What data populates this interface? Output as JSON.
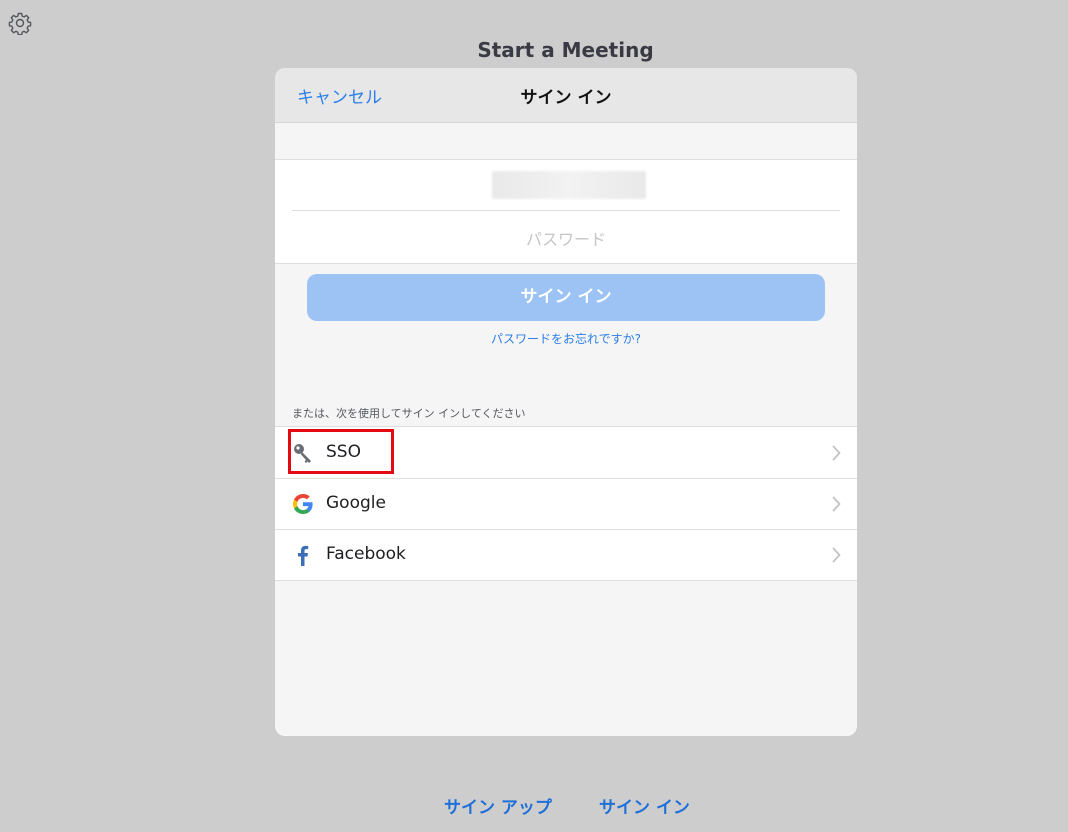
{
  "header": {
    "title": "Start a Meeting"
  },
  "modal": {
    "cancel_label": "キャンセル",
    "title": "サイン イン",
    "password_placeholder": "パスワード",
    "signin_label": "サイン イン",
    "forgot_label": "パスワードをお忘れですか?",
    "or_label": "または、次を使用してサイン インしてください",
    "options": [
      {
        "label": "SSO",
        "icon": "key-icon"
      },
      {
        "label": "Google",
        "icon": "google-icon"
      },
      {
        "label": "Facebook",
        "icon": "facebook-icon"
      }
    ]
  },
  "footer": {
    "signup_label": "サイン アップ",
    "signin_label": "サイン イン"
  },
  "colors": {
    "accent": "#2b7ee9",
    "button_disabled": "#9cc3f4",
    "highlight": "#e40a12",
    "background": "#cdcdcd"
  }
}
